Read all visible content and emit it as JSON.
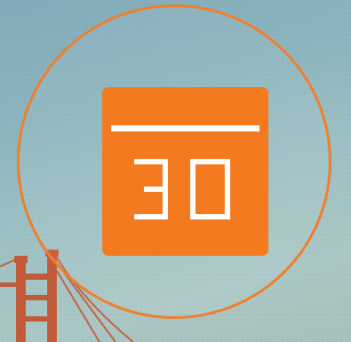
{
  "app_icon": {
    "day_number": "30",
    "accent_color": "#f47a1f",
    "ring_color": "#ef7f2c",
    "glyph_color": "#ffffff",
    "background_colors": [
      "#7fa9b8",
      "#a9c6c4"
    ],
    "icon_name": "calendar-icon",
    "background_scene": "golden-gate-bridge-photo"
  }
}
